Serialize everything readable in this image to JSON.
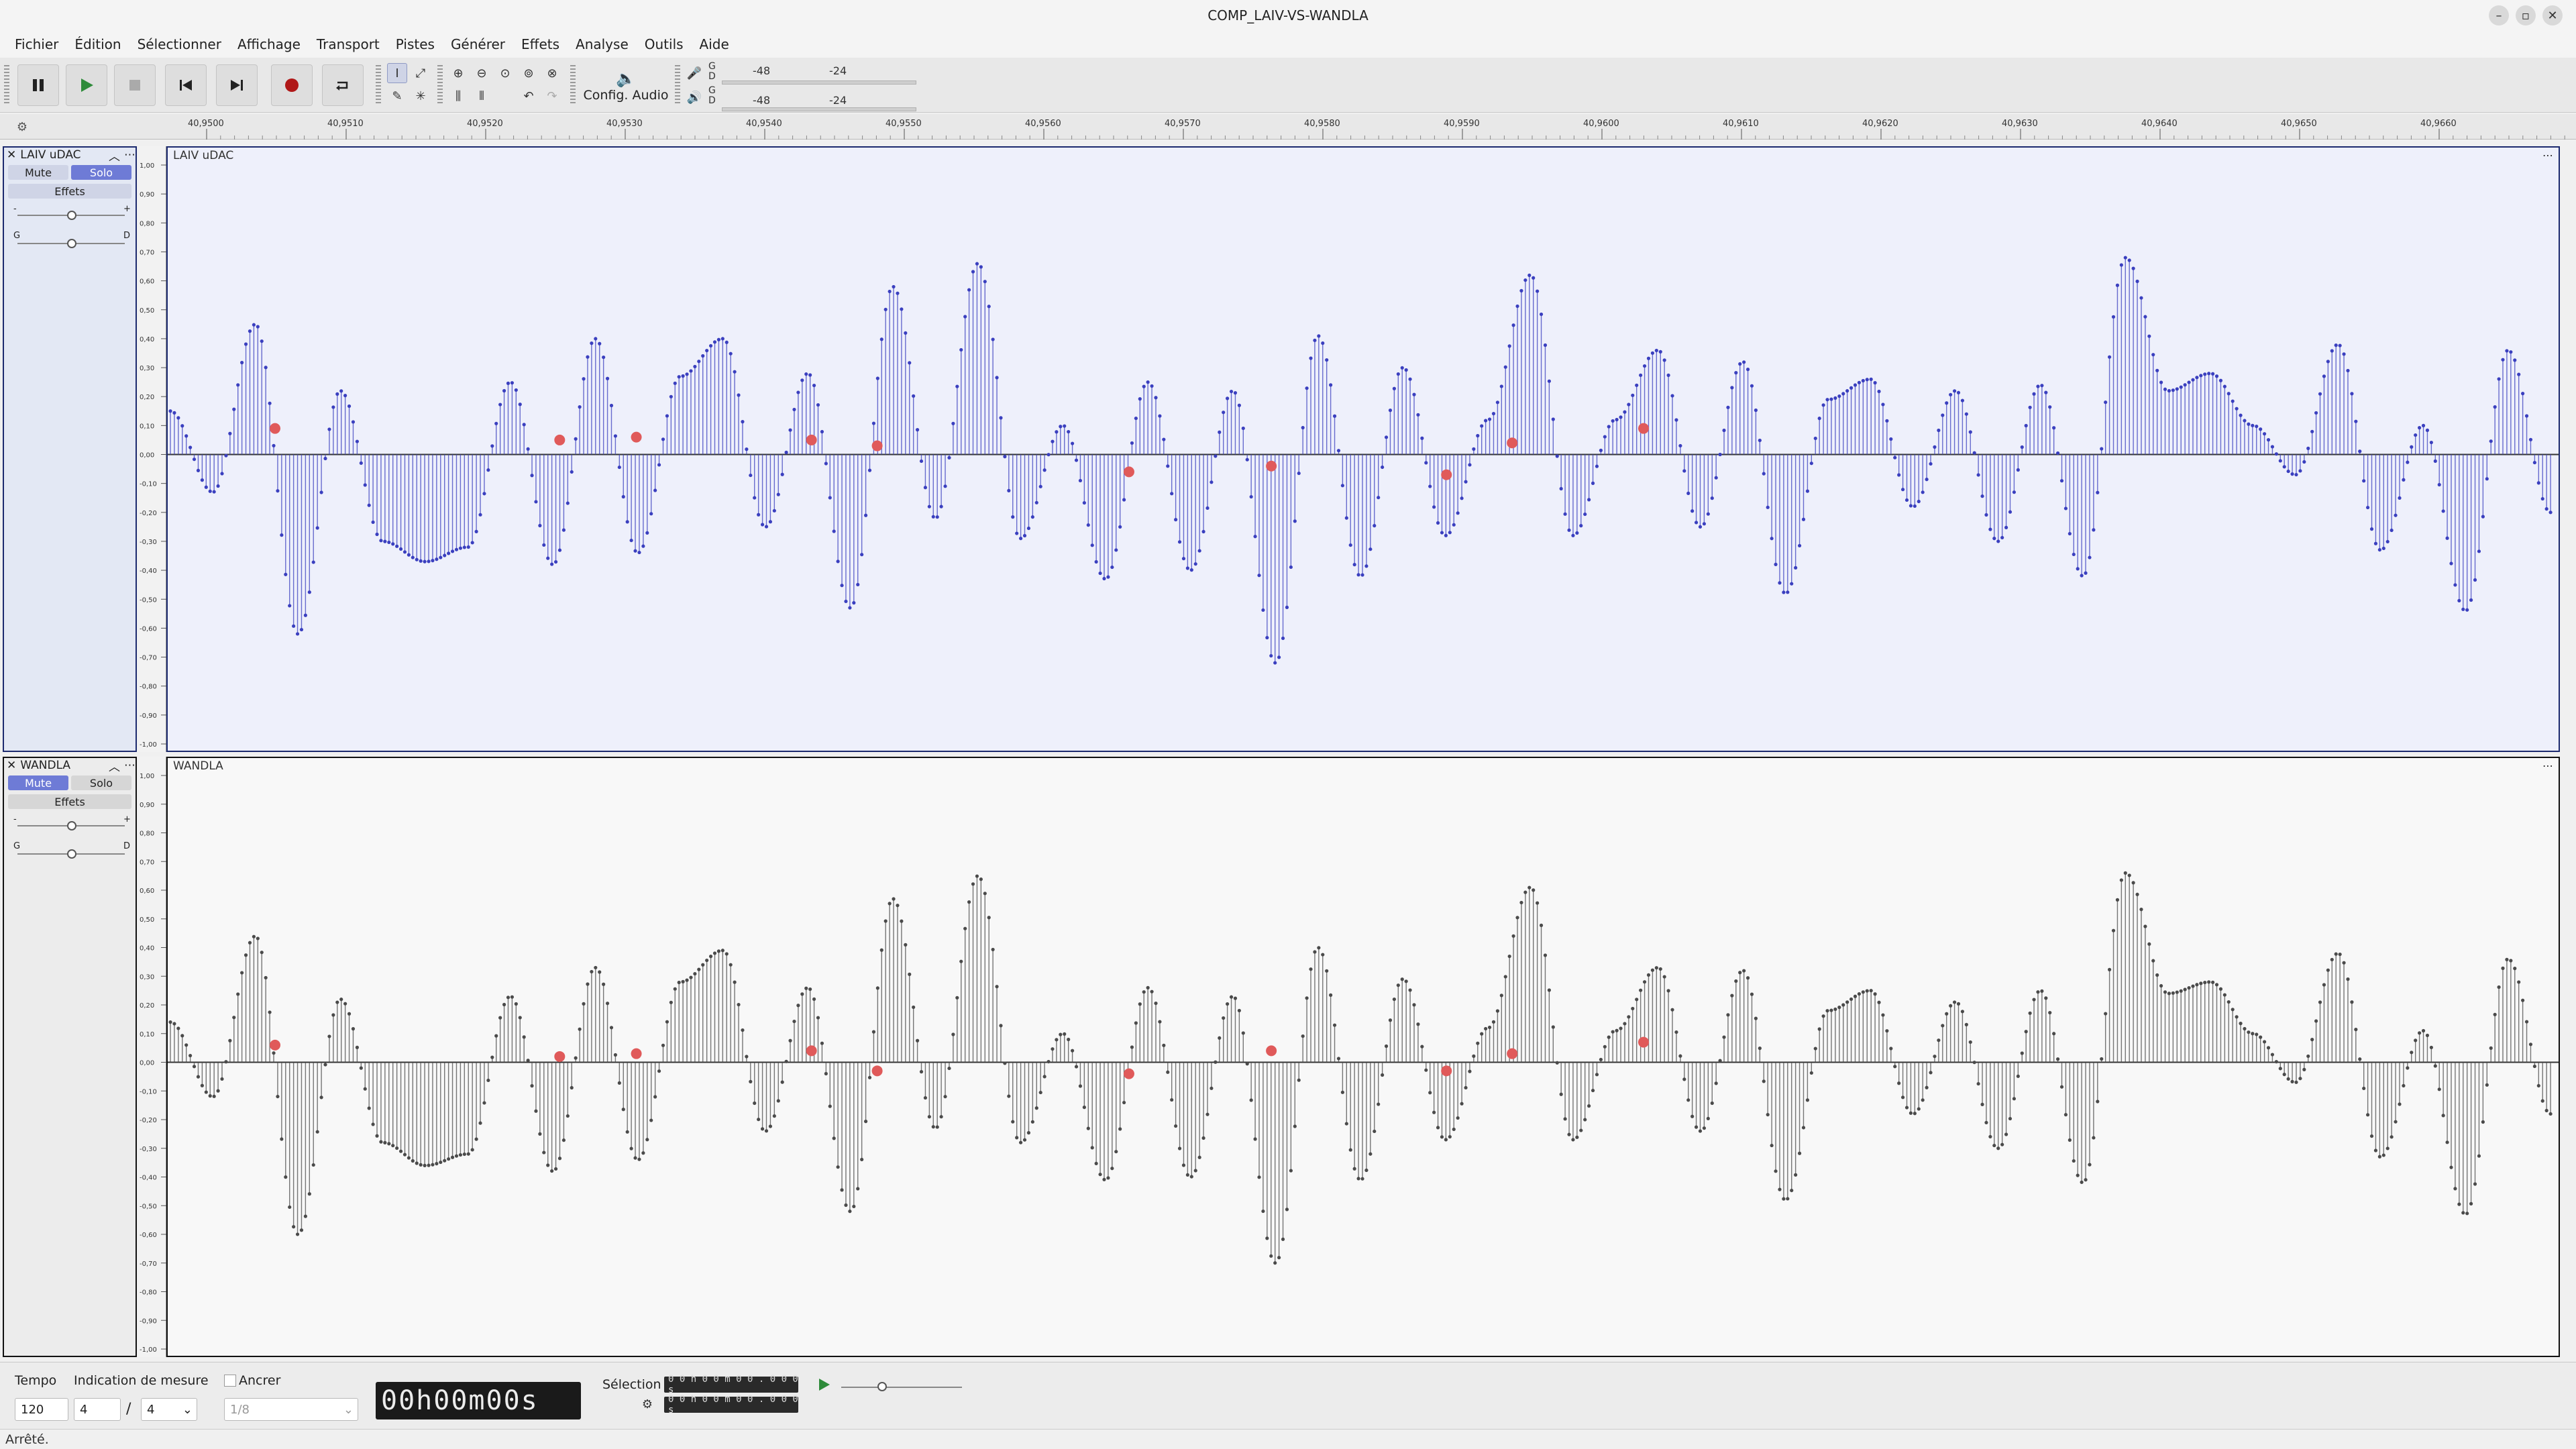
{
  "window": {
    "title": "COMP_LAIV-VS-WANDLA"
  },
  "menu": [
    "Fichier",
    "Édition",
    "Sélectionner",
    "Affichage",
    "Transport",
    "Pistes",
    "Générer",
    "Effets",
    "Analyse",
    "Outils",
    "Aide"
  ],
  "toolbar": {
    "config_audio": "Config. Audio",
    "meter_rec": [
      "-48",
      "-24"
    ],
    "meter_play": [
      "-48",
      "-24"
    ],
    "meter_lr": [
      "G",
      "D"
    ]
  },
  "ruler": {
    "ticks": [
      "40,9500",
      "40,9510",
      "40,9520",
      "40,9530",
      "40,9540",
      "40,9550",
      "40,9560",
      "40,9570",
      "40,9580",
      "40,9590",
      "40,9600",
      "40,9610",
      "40,9620",
      "40,9630",
      "40,9640",
      "40,9650",
      "40,9660"
    ]
  },
  "vruler_ticks": [
    "1,00",
    "0,90",
    "0,80",
    "0,70",
    "0,60",
    "0,50",
    "0,40",
    "0,30",
    "0,20",
    "0,10",
    "0,00",
    "-0,10",
    "-0,20",
    "-0,30",
    "-0,40",
    "-0,50",
    "-0,60",
    "-0,70",
    "-0,80",
    "-0,90",
    "-1,00"
  ],
  "tracks": [
    {
      "name": "LAIV uDAC",
      "mute": "Mute",
      "solo": "Solo",
      "effects": "Effets",
      "pan_l": "G",
      "pan_r": "D",
      "gain_minus": "-",
      "gain_plus": "+",
      "selected": true,
      "solo_active": true,
      "mute_active": false,
      "color": "#3a3fbf",
      "peaks": [
        0.15,
        -0.13,
        0.45,
        -0.62,
        0.22,
        -0.3,
        -0.37,
        -0.32,
        0.25,
        -0.38,
        0.4,
        -0.34,
        0.27,
        0.4,
        -0.25,
        0.28,
        -0.53,
        0.58,
        -0.22,
        0.66,
        -0.29,
        0.1,
        -0.43,
        0.25,
        -0.4,
        0.22,
        -0.72,
        0.41,
        -0.42,
        0.3,
        -0.28,
        0.12,
        0.62,
        -0.28,
        0.12,
        0.36,
        -0.25,
        0.32,
        -0.48,
        0.19,
        0.26,
        -0.18,
        0.22,
        -0.3,
        0.24,
        -0.42,
        0.68,
        0.22,
        0.28,
        0.1,
        -0.07,
        0.38,
        -0.33,
        0.1,
        -0.54,
        0.36,
        -0.2
      ],
      "markers": [
        0.09,
        0.05,
        0.06,
        0.05,
        0.03,
        -0.06,
        -0.04,
        -0.07,
        0.04,
        0.09
      ]
    },
    {
      "name": "WANDLA",
      "mute": "Mute",
      "solo": "Solo",
      "effects": "Effets",
      "pan_l": "G",
      "pan_r": "D",
      "gain_minus": "-",
      "gain_plus": "+",
      "selected": false,
      "solo_active": false,
      "mute_active": true,
      "color": "#4a4a4a",
      "peaks": [
        0.14,
        -0.12,
        0.44,
        -0.6,
        0.22,
        -0.28,
        -0.36,
        -0.32,
        0.23,
        -0.38,
        0.33,
        -0.34,
        0.28,
        0.39,
        -0.24,
        0.26,
        -0.52,
        0.57,
        -0.23,
        0.65,
        -0.28,
        0.1,
        -0.41,
        0.26,
        -0.4,
        0.23,
        -0.7,
        0.4,
        -0.41,
        0.29,
        -0.27,
        0.12,
        0.61,
        -0.27,
        0.11,
        0.33,
        -0.24,
        0.32,
        -0.48,
        0.18,
        0.25,
        -0.18,
        0.21,
        -0.3,
        0.25,
        -0.42,
        0.66,
        0.24,
        0.28,
        0.1,
        -0.07,
        0.38,
        -0.33,
        0.11,
        -0.53,
        0.36,
        -0.18
      ],
      "markers": [
        0.06,
        0.02,
        0.03,
        0.04,
        -0.03,
        -0.04,
        0.04,
        -0.03,
        0.03,
        0.07
      ]
    }
  ],
  "bottom": {
    "tempo_label": "Tempo",
    "tempo_value": "120",
    "signature_label": "Indication de mesure",
    "sig_top": "4",
    "sig_bottom": "4",
    "snap_label": "Ancrer",
    "snap_value": "1/8",
    "time": "00h00m00s",
    "selection_label": "Sélection",
    "sel_start": "0 0 h 0 0 m 0 0 . 0 0 0 s",
    "sel_end": "0 0 h 0 0 m 0 0 . 0 0 0 s"
  },
  "status": "Arrêté."
}
